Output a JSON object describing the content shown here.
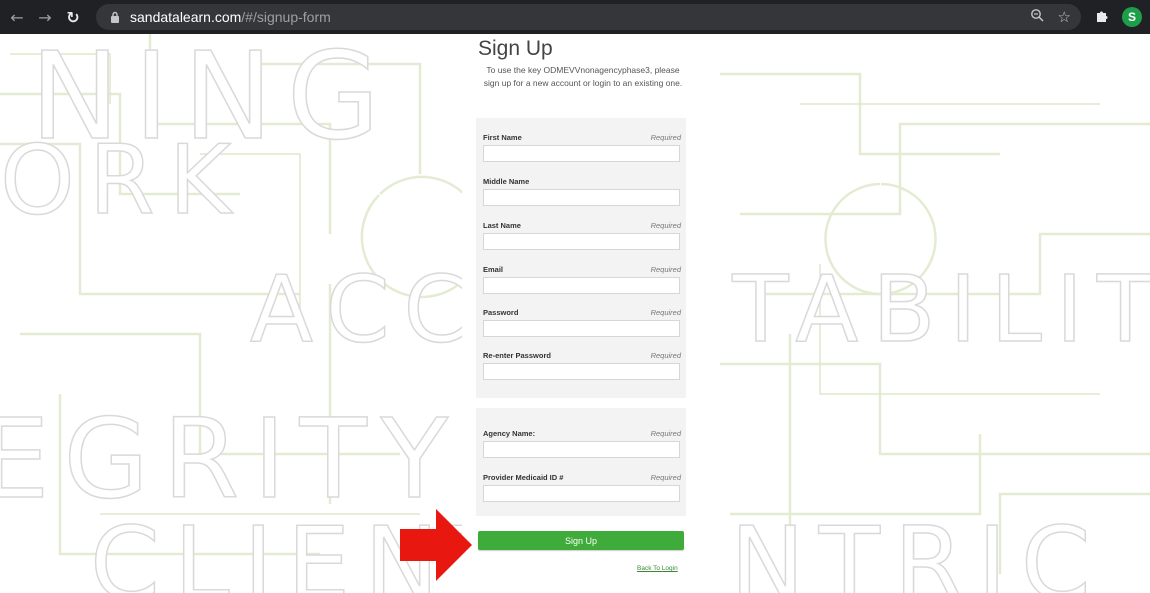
{
  "browser": {
    "url_host": "sandatalearn.com",
    "url_path": "/#/signup-form",
    "avatar_letter": "S",
    "icons": [
      "back-icon",
      "forward-icon",
      "reload-icon",
      "lock-icon",
      "zoom-icon",
      "star-icon",
      "extensions-icon"
    ]
  },
  "background": {
    "words": [
      "NING",
      "ORK",
      "ACCOUNTABILITY",
      "EGRITY",
      "CLIENT-CENTRIC"
    ]
  },
  "form": {
    "title": "Sign Up",
    "intro": "To use the key ODMEVVnonagencyphase3, please sign up for a new account or login to an existing one.",
    "fields": [
      {
        "label": "First Name",
        "required": "Required"
      },
      {
        "label": "Middle Name",
        "required": ""
      },
      {
        "label": "Last Name",
        "required": "Required"
      },
      {
        "label": "Email",
        "required": "Required"
      },
      {
        "label": "Password",
        "required": "Required"
      },
      {
        "label": "Re-enter Password",
        "required": "Required"
      }
    ],
    "agency_fields": [
      {
        "label": "Agency Name:",
        "required": "Required"
      },
      {
        "label": "Provider Medicaid ID #",
        "required": "Required"
      }
    ],
    "submit_label": "Sign Up",
    "back_link": "Back To Login"
  },
  "colors": {
    "accent_green": "#3fab3a",
    "arrow_red": "#e8170f",
    "chrome_dark": "#202124"
  }
}
